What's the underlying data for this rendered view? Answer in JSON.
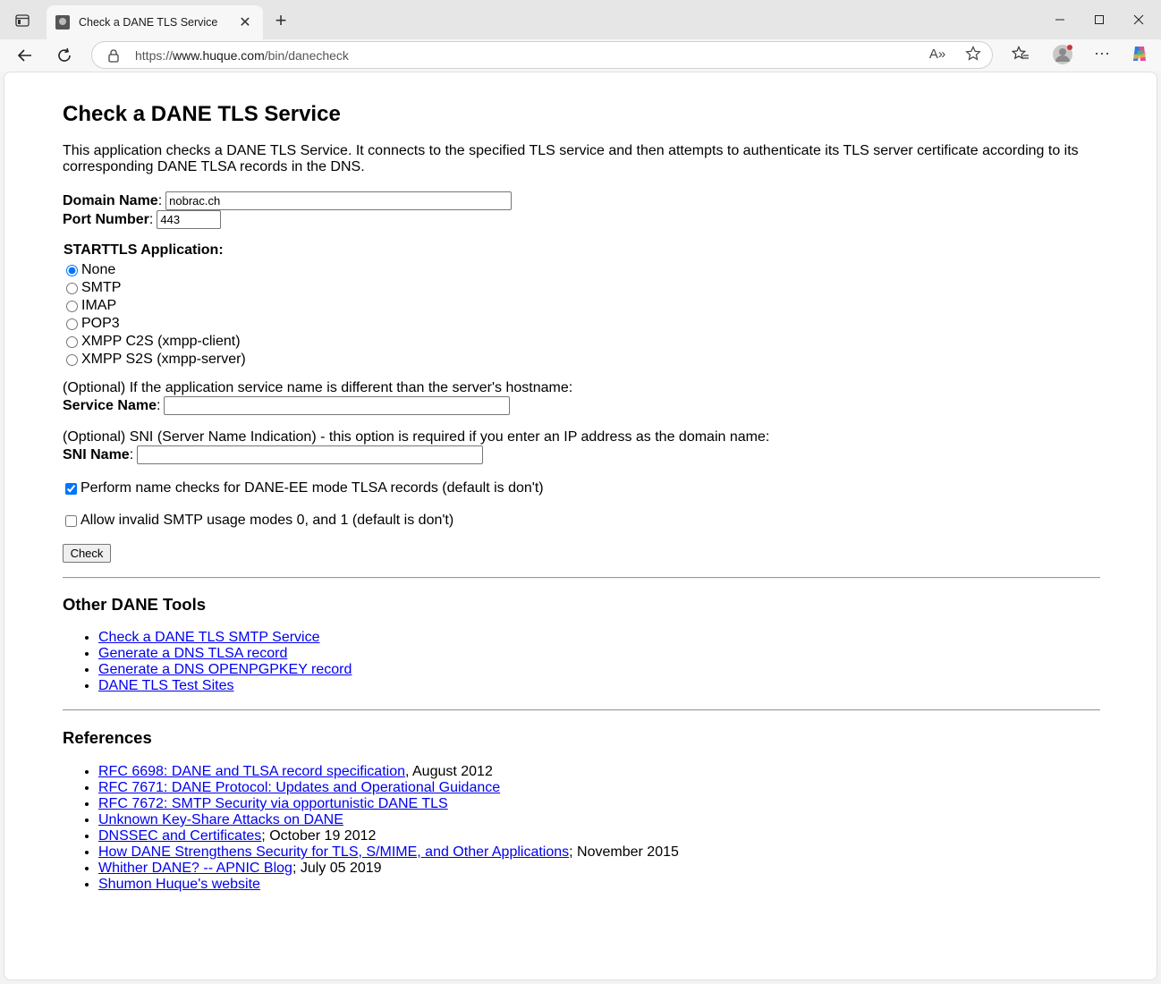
{
  "browser": {
    "tab_title": "Check a DANE TLS Service",
    "url_prefix": "https://",
    "url_host": "www.huque.com",
    "url_path": "/bin/danecheck",
    "read_aloud_label": "A»"
  },
  "page": {
    "title": "Check a DANE TLS Service",
    "intro": "This application checks a DANE TLS Service. It connects to the specified TLS service and then attempts to authenticate its TLS server certificate according to its corresponding DANE TLSA records in the DNS.",
    "domain_label": "Domain Name",
    "domain_value": "nobrac.ch",
    "port_label": "Port Number",
    "port_value": "443",
    "starttls_label": "STARTTLS Application:",
    "starttls_options": [
      "None",
      "SMTP",
      "IMAP",
      "POP3",
      "XMPP C2S (xmpp-client)",
      "XMPP S2S (xmpp-server)"
    ],
    "starttls_selected": "None",
    "service_hint": "(Optional) If the application service name is different than the server's hostname:",
    "service_label": "Service Name",
    "service_value": "",
    "sni_hint": "(Optional) SNI (Server Name Indication) - this option is required if you enter an IP address as the domain name:",
    "sni_label": "SNI Name",
    "sni_value": "",
    "name_checks_label": "Perform name checks for DANE-EE mode TLSA records (default is don't)",
    "name_checks_checked": true,
    "smtp_modes_label": "Allow invalid SMTP usage modes 0, and 1 (default is don't)",
    "smtp_modes_checked": false,
    "check_button": "Check",
    "colon": ":"
  },
  "other_tools": {
    "heading": "Other DANE Tools",
    "links": [
      "Check a DANE TLS SMTP Service",
      "Generate a DNS TLSA record",
      "Generate a DNS OPENPGPKEY record",
      "DANE TLS Test Sites"
    ]
  },
  "references": {
    "heading": "References",
    "items": [
      {
        "link": "RFC 6698: DANE and TLSA record specification",
        "suffix": ", August 2012"
      },
      {
        "link": "RFC 7671: DANE Protocol: Updates and Operational Guidance",
        "suffix": ""
      },
      {
        "link": "RFC 7672: SMTP Security via opportunistic DANE TLS",
        "suffix": ""
      },
      {
        "link": "Unknown Key-Share Attacks on DANE",
        "suffix": ""
      },
      {
        "link": "DNSSEC and Certificates",
        "suffix": "; October 19 2012"
      },
      {
        "link": "How DANE Strengthens Security for TLS, S/MIME, and Other Applications",
        "suffix": "; November 2015"
      },
      {
        "link": "Whither DANE? -- APNIC Blog",
        "suffix": "; July 05 2019"
      },
      {
        "link": "Shumon Huque's website",
        "suffix": ""
      }
    ]
  },
  "colors": {
    "link": "#0000ee",
    "accent": "#0067c0"
  }
}
